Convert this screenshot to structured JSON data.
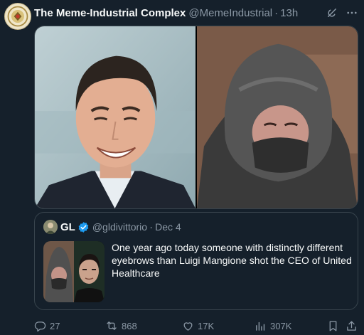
{
  "tweet": {
    "author_name": "The Meme-Industrial Complex",
    "author_handle": "@MemeIndustrial",
    "separator": "·",
    "time": "13h",
    "icons": {
      "grok": "grok-icon",
      "more": "more-icon",
      "avatar": "seal-avatar"
    },
    "media": {
      "left_image": "smiling-man-suit-photo",
      "right_image": "hooded-figure-photo"
    }
  },
  "quote": {
    "author_name": "GL",
    "verified_icon": "verified-badge-icon",
    "author_handle": "@gldivittorio",
    "separator": "·",
    "time": "Dec 4",
    "text": "One year ago today someone with distinctly different eyebrows than Luigi Mangione shot the CEO of United Healthcare",
    "media": {
      "left_image": "hooded-figure-thumbnail",
      "right_image": "man-portrait-thumbnail"
    }
  },
  "actions": {
    "replies": "27",
    "reposts": "868",
    "likes": "17K",
    "views": "307K",
    "icons": [
      "reply-icon",
      "repost-icon",
      "like-icon",
      "views-icon",
      "bookmark-icon",
      "share-icon"
    ]
  },
  "colors": {
    "background": "#15202b",
    "text_primary": "#f7f9f9",
    "text_secondary": "#8b98a5",
    "border": "#38444d",
    "verified": "#1d9bf0"
  }
}
